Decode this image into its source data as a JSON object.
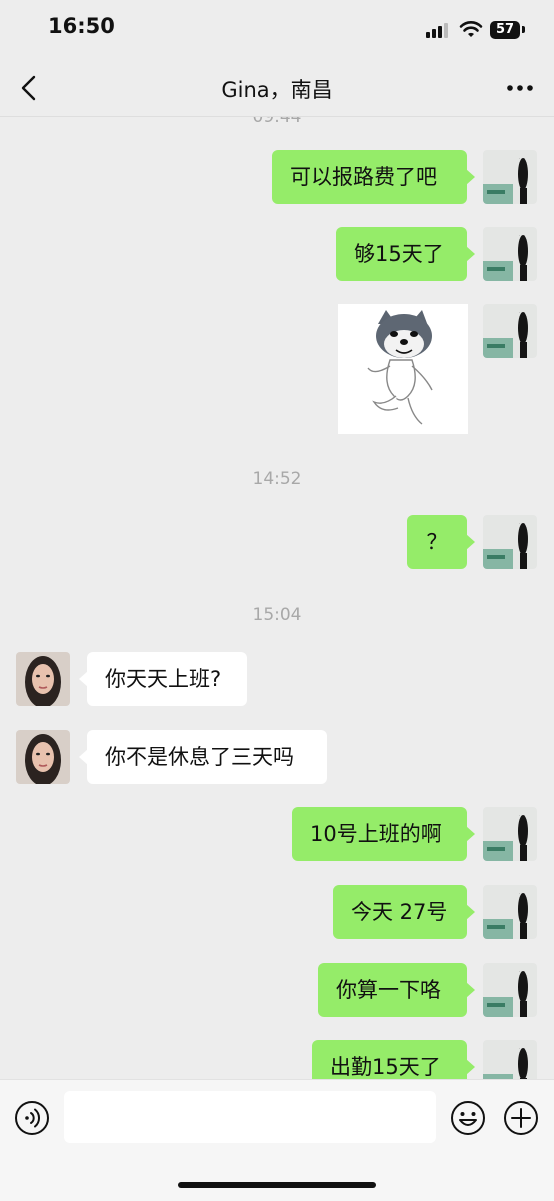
{
  "status_bar": {
    "time": "16:50",
    "battery": "57"
  },
  "header": {
    "title": "Gina，南昌"
  },
  "timestamps": {
    "clipped": "09:44",
    "t1": "14:52",
    "t2": "15:04"
  },
  "messages": [
    {
      "side": "out",
      "type": "text",
      "text": "可以报路费了吧"
    },
    {
      "side": "out",
      "type": "text",
      "text": "够15天了"
    },
    {
      "side": "out",
      "type": "sticker",
      "sticker": "dog-dancing-sticker"
    },
    {
      "side": "out",
      "type": "text",
      "text": "？"
    },
    {
      "side": "in",
      "type": "text",
      "text": "你天天上班?"
    },
    {
      "side": "in",
      "type": "text",
      "text": "你不是休息了三天吗"
    },
    {
      "side": "out",
      "type": "text",
      "text": "10号上班的啊"
    },
    {
      "side": "out",
      "type": "text",
      "text": "今天 27号"
    },
    {
      "side": "out",
      "type": "text",
      "text": "你算一下咯"
    },
    {
      "side": "out",
      "type": "text",
      "text": "出勤15天了"
    }
  ],
  "input": {
    "value": ""
  },
  "icons": {
    "back": "back-chevron-icon",
    "more": "more-dots-icon",
    "voice": "voice-icon",
    "emoji": "emoji-icon",
    "plus": "plus-icon"
  },
  "colors": {
    "outgoing_bubble": "#95ec69",
    "incoming_bubble": "#ffffff",
    "background": "#ededed"
  }
}
